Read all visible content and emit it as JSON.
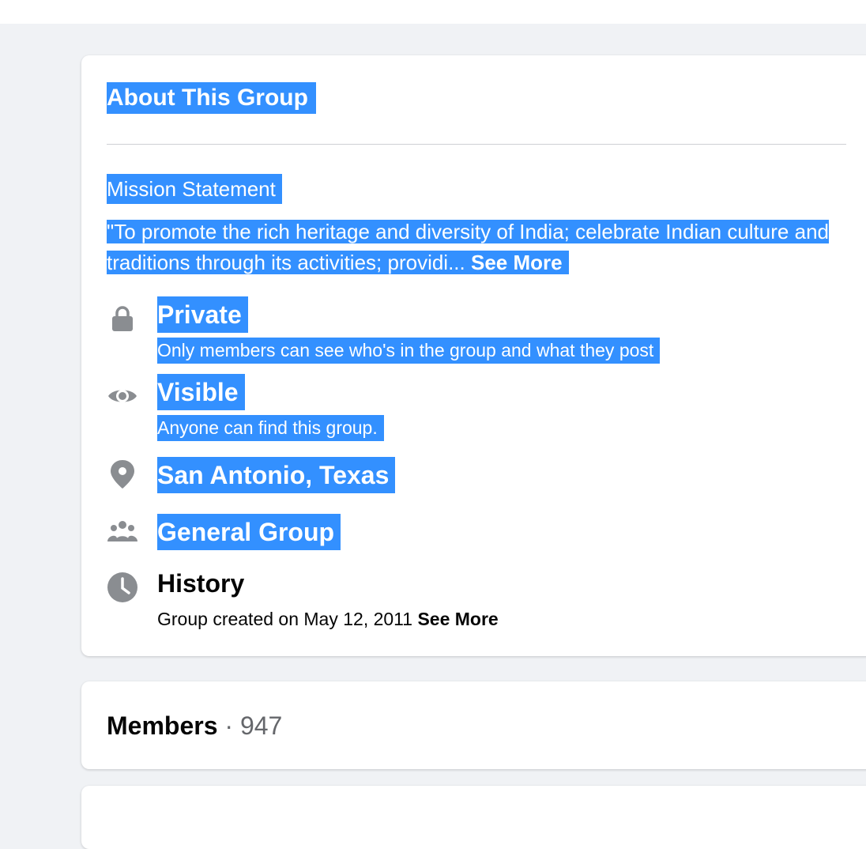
{
  "about": {
    "title": "About This Group",
    "mission_label": "Mission Statement",
    "mission_text": "\"To promote the rich heritage and diversity of India; celebrate Indian culture and traditions through its activities; providi...",
    "mission_see_more": "See More",
    "privacy": {
      "icon": "lock-icon",
      "title": "Private",
      "description": "Only members can see who's in the group and what they post"
    },
    "visibility": {
      "icon": "eye-icon",
      "title": "Visible",
      "description": "Anyone can find this group."
    },
    "location": {
      "icon": "location-pin-icon",
      "title": "San Antonio, Texas"
    },
    "group_type": {
      "icon": "people-group-icon",
      "title": "General Group"
    },
    "history": {
      "icon": "clock-icon",
      "title": "History",
      "description": "Group created on May 12, 2011",
      "see_more": "See More"
    }
  },
  "members": {
    "label": "Members",
    "separator": "·",
    "count": "947"
  },
  "colors": {
    "selection": "#3390ff",
    "icon": "#8a8d91",
    "page_bg": "#f0f2f5",
    "muted_text": "#65676b"
  }
}
